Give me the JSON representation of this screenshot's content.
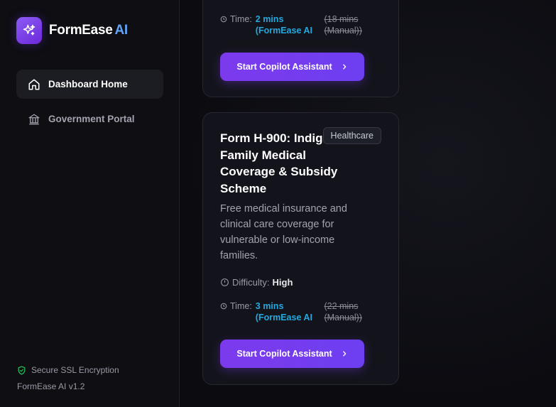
{
  "brand": {
    "name": "FormEase",
    "suffix": "AI",
    "logo_icon": "sparkles-icon"
  },
  "nav": [
    {
      "label": "Dashboard Home",
      "icon": "home-icon",
      "active": true
    },
    {
      "label": "Government Portal",
      "icon": "bank-icon",
      "active": false
    }
  ],
  "footer": {
    "ssl": "Secure SSL Encryption",
    "version": "FormEase AI v1.2"
  },
  "cards": [
    {
      "time_label": "Time:",
      "time_ai": "2 mins (FormEase AI",
      "time_manual": "(18 mins (Manual))",
      "cta": "Start Copilot Assistant"
    },
    {
      "title": "Form H-900: Indigent Family Medical Coverage & Subsidy Scheme",
      "tag": "Healthcare",
      "description": "Free medical insurance and clinical care coverage for vulnerable or low-income families.",
      "difficulty_label": "Difficulty:",
      "difficulty": "High",
      "time_label": "Time:",
      "time_ai": "3 mins (FormEase AI",
      "time_manual": "(22 mins (Manual))",
      "cta": "Start Copilot Assistant"
    }
  ],
  "colors": {
    "accent": "#7c3aed",
    "time_ai": "#22a9e0",
    "brand_ai": "#60a5fa",
    "ssl": "#22c55e"
  }
}
